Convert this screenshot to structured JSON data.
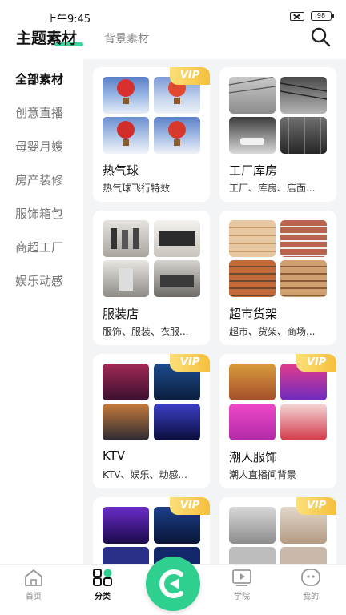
{
  "status": {
    "time": "上午9:45",
    "battery": "98"
  },
  "header": {
    "active_tab": "主题素材",
    "inactive_tab": "背景素材"
  },
  "sidebar": {
    "items": [
      {
        "label": "全部素材",
        "active": true
      },
      {
        "label": "创意直播"
      },
      {
        "label": "母婴月嫂"
      },
      {
        "label": "房产装修"
      },
      {
        "label": "服饰箱包"
      },
      {
        "label": "商超工厂"
      },
      {
        "label": "娱乐动感"
      }
    ]
  },
  "vip_label": "VIP",
  "cards": [
    {
      "title": "热气球",
      "subtitle": "热气球飞行特效",
      "vip": true
    },
    {
      "title": "工厂库房",
      "subtitle": "工厂、库房、店面...",
      "vip": false
    },
    {
      "title": "服装店",
      "subtitle": "服饰、服装、衣服...",
      "vip": false
    },
    {
      "title": "超市货架",
      "subtitle": "超市、货架、商场...",
      "vip": false
    },
    {
      "title": "KTV",
      "subtitle": "KTV、娱乐、动感...",
      "vip": true
    },
    {
      "title": "潮人服饰",
      "subtitle": "潮人直播间背景",
      "vip": true
    },
    {
      "title": "",
      "subtitle": "",
      "vip": true
    },
    {
      "title": "",
      "subtitle": "",
      "vip": true
    }
  ],
  "bottom_nav": [
    {
      "label": "首页",
      "icon": "home-icon"
    },
    {
      "label": "分类",
      "icon": "category-icon",
      "active": true
    },
    {
      "label": "",
      "icon": "create-icon"
    },
    {
      "label": "学院",
      "icon": "video-icon"
    },
    {
      "label": "我的",
      "icon": "profile-icon"
    }
  ],
  "colors": {
    "accent": "#2fcf8f",
    "vip_gold": "#f6bf3b",
    "underline": "#3ed39a"
  }
}
